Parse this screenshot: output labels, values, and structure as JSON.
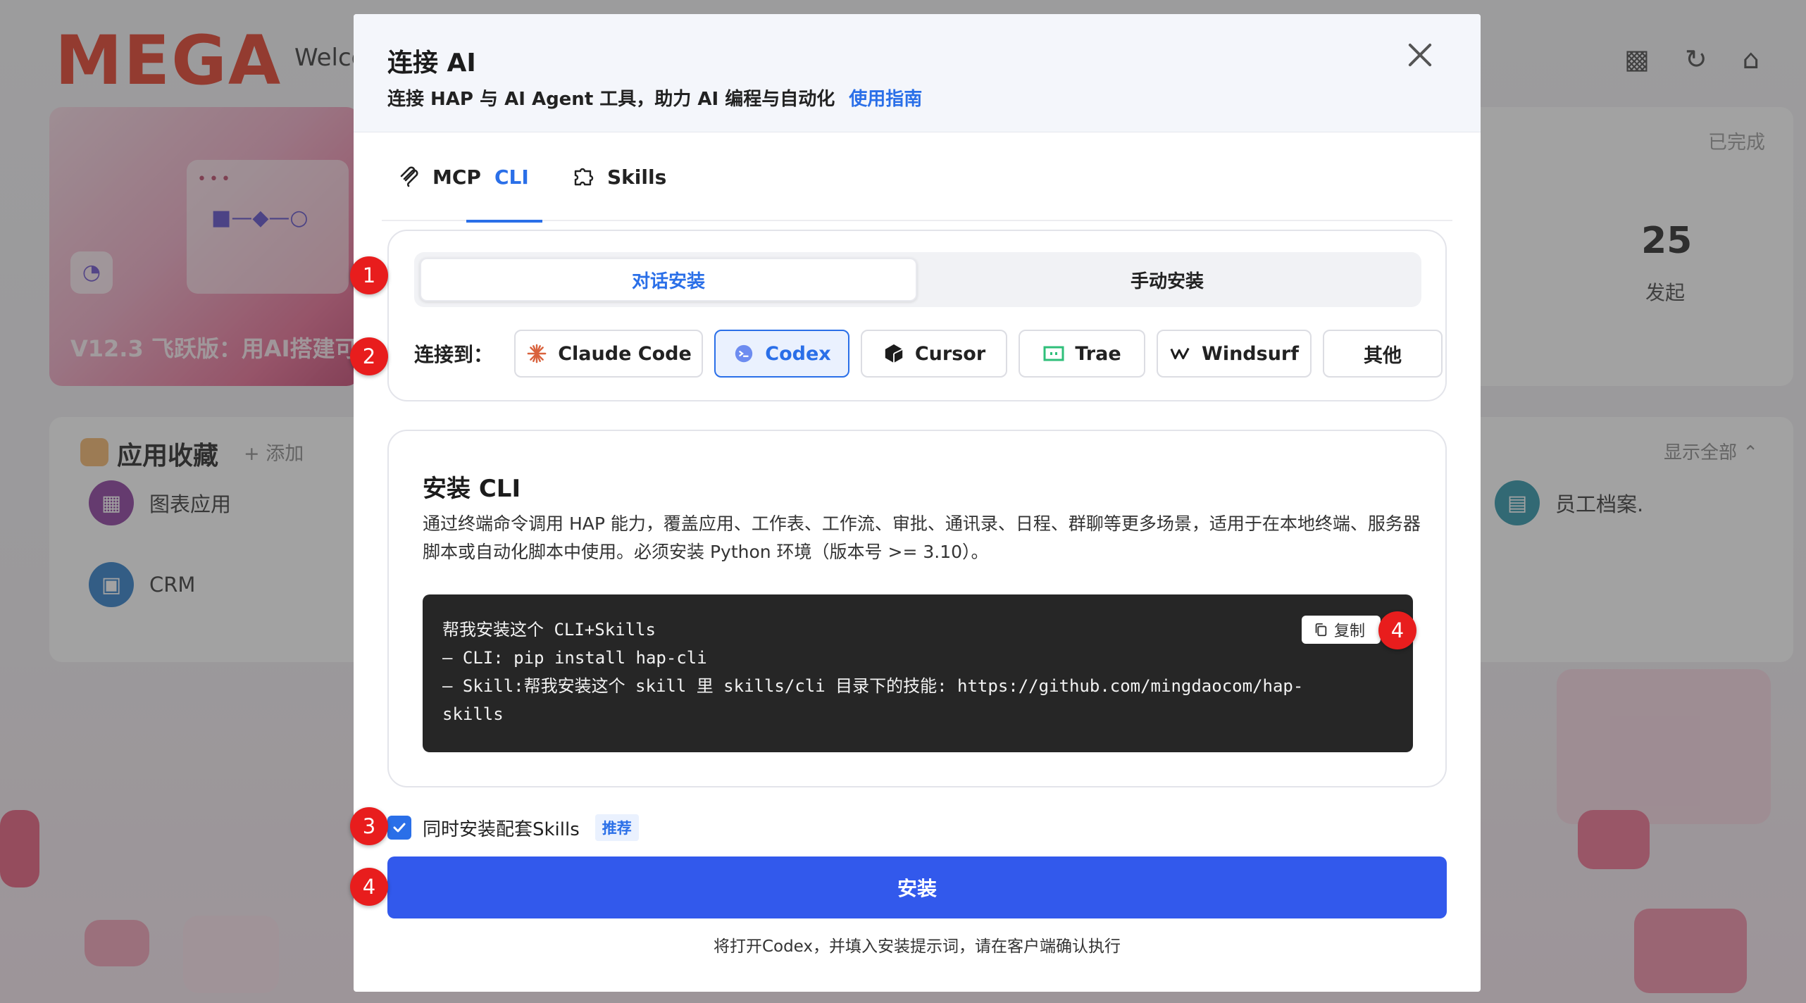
{
  "background": {
    "brand": "MEGA",
    "welcome": "Welco",
    "banner_caption": "V12.3 飞跃版：用AI搭建可",
    "stats": {
      "status": "已完成",
      "count": "25",
      "count_label": "发起"
    },
    "favorites": {
      "title": "应用收藏",
      "add": "+ 添加",
      "show_all": "显示全部 ⌃",
      "apps": [
        {
          "name": "图表应用",
          "color": "#8a3b9e"
        },
        {
          "name": "CRM",
          "color": "#2b7bc8"
        },
        {
          "name": "员工档案.",
          "color": "#2a92a8"
        }
      ]
    }
  },
  "modal": {
    "title": "连接 AI",
    "subtitle": "连接 HAP 与 AI Agent 工具，助力 AI 编程与自动化",
    "guide_link": "使用指南",
    "tabs": [
      {
        "label": "MCP",
        "icon": "mcp-icon"
      },
      {
        "label": "CLI",
        "icon": "code-icon"
      },
      {
        "label": "Skills",
        "icon": "puzzle-icon"
      }
    ],
    "active_tab": "CLI",
    "install_modes": {
      "chat": "对话安装",
      "manual": "手动安装",
      "selected": "对话安装"
    },
    "connect_label": "连接到：",
    "agents": [
      {
        "label": "Claude Code",
        "icon": "claude-icon"
      },
      {
        "label": "Codex",
        "icon": "codex-icon"
      },
      {
        "label": "Cursor",
        "icon": "cursor-icon"
      },
      {
        "label": "Trae",
        "icon": "trae-icon"
      },
      {
        "label": "Windsurf",
        "icon": "windsurf-icon"
      },
      {
        "label": "其他",
        "icon": ""
      }
    ],
    "selected_agent": "Codex",
    "section_title": "安装 CLI",
    "section_desc": "通过终端命令调用 HAP 能力，覆盖应用、工作表、工作流、审批、通讯录、日程、群聊等更多场景，适用于在本地终端、服务器脚本或自动化脚本中使用。必须安装 Python 环境（版本号 >= 3.10）。",
    "code_lines": [
      "帮我安装这个 CLI+Skills",
      "— CLI: pip install hap-cli",
      "— Skill:帮我安装这个 skill 里 skills/cli 目录下的技能: https://github.com/mingdaocom/hap-",
      "skills"
    ],
    "copy_label": "复制",
    "checkbox_label": "同时安装配套Skills",
    "checkbox_checked": true,
    "recommend_badge": "推荐",
    "install_button": "安装",
    "hint": "将打开Codex，并填入安装提示词，请在客户端确认执行"
  },
  "steps": [
    "1",
    "2",
    "3",
    "4",
    "4"
  ],
  "colors": {
    "accent": "#2a6fe8",
    "install_button": "#3259ec",
    "step_badge": "#e81d1d",
    "brand": "#e33a26"
  }
}
